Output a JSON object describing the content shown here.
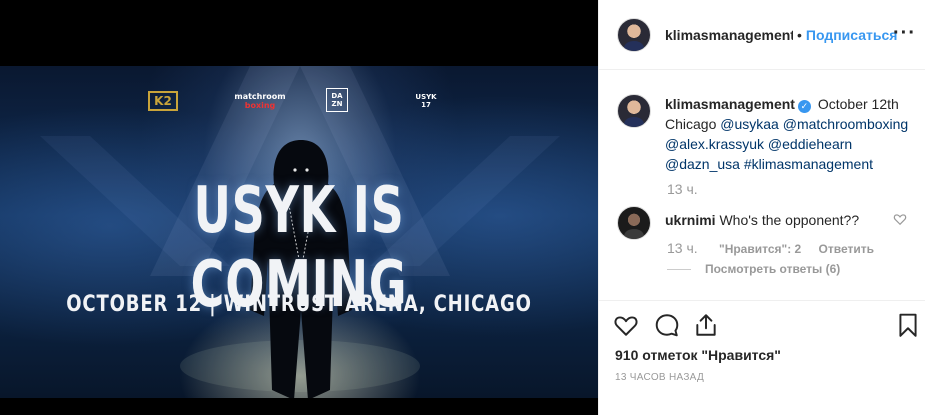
{
  "post": {
    "image": {
      "logos": [
        "K2",
        "matchroom",
        "boxing",
        "DA",
        "ZN",
        "USYK",
        "17"
      ],
      "headline": "USYK IS COMING",
      "subline": "OCTOBER 12  |  WINTRUST ARENA, CHICAGO"
    }
  },
  "header": {
    "username": "klimasmanagement",
    "separator": "•",
    "follow_label": "Подписаться",
    "more_icon": "more-options-icon",
    "more_glyph": "···"
  },
  "caption": {
    "username": "klimasmanagement",
    "verified_glyph": "✓",
    "text_start": "October 12th Chicago",
    "mentions": [
      "@usykaa",
      "@matchroomboxing",
      "@alex.krassyuk",
      "@eddiehearn",
      "@dazn_usa"
    ],
    "hashtag": "#klimasmanagement",
    "time": "13 ч."
  },
  "comment": {
    "username": "ukrnimi",
    "text": "Who's the opponent??",
    "time": "13 ч.",
    "likes_label": "\"Нравится\": 2",
    "reply_label": "Ответить",
    "view_replies": "Посмотреть ответы (6)"
  },
  "actions": {
    "likes_text": "910 отметок \"Нравится\"",
    "posted_ago": "13 ЧАСОВ НАЗАД",
    "icons": [
      "heart-icon",
      "comment-icon",
      "share-icon",
      "bookmark-icon"
    ]
  },
  "colors": {
    "accent": "#3897f0",
    "text": "#262626",
    "muted": "#999999",
    "media_bg": "#000000"
  }
}
